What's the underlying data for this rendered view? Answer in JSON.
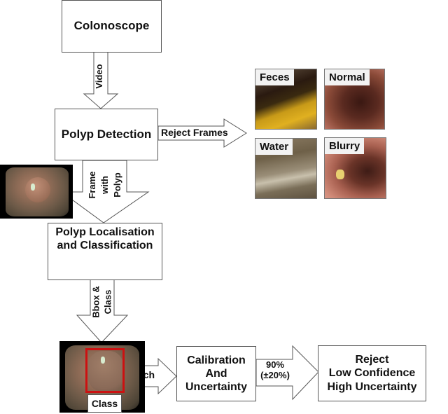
{
  "nodes": {
    "colonoscope": {
      "label": "Colonoscope"
    },
    "polyp_detection": {
      "label": "Polyp Detection"
    },
    "localisation": {
      "line1": "Polyp Localisation",
      "line2": "and Classification"
    },
    "calibration": {
      "line1": "Calibration",
      "line2": "And",
      "line3": "Uncertainty"
    },
    "reject": {
      "line1": "Reject",
      "line2": "Low Confidence",
      "line3": "High Uncertainty"
    }
  },
  "arrows": {
    "video": {
      "label": "Video"
    },
    "reject_frames": {
      "label": "Reject Frames"
    },
    "frame_with_polyp": {
      "line1": "Frame",
      "line2": "with",
      "line3": "Polyp"
    },
    "bbox_class": {
      "line1": "Bbox &",
      "line2": "Class"
    },
    "patch": {
      "label": "Patch"
    },
    "threshold": {
      "line1": "90%",
      "line2": "(±20%)"
    }
  },
  "rejected_frames": [
    {
      "label": "Feces"
    },
    {
      "label": "Normal"
    },
    {
      "label": "Water"
    },
    {
      "label": "Blurry"
    }
  ],
  "output_image": {
    "class_label": "Class"
  },
  "colors": {
    "box_border": "#555555",
    "bbox_red": "#cc1111"
  }
}
